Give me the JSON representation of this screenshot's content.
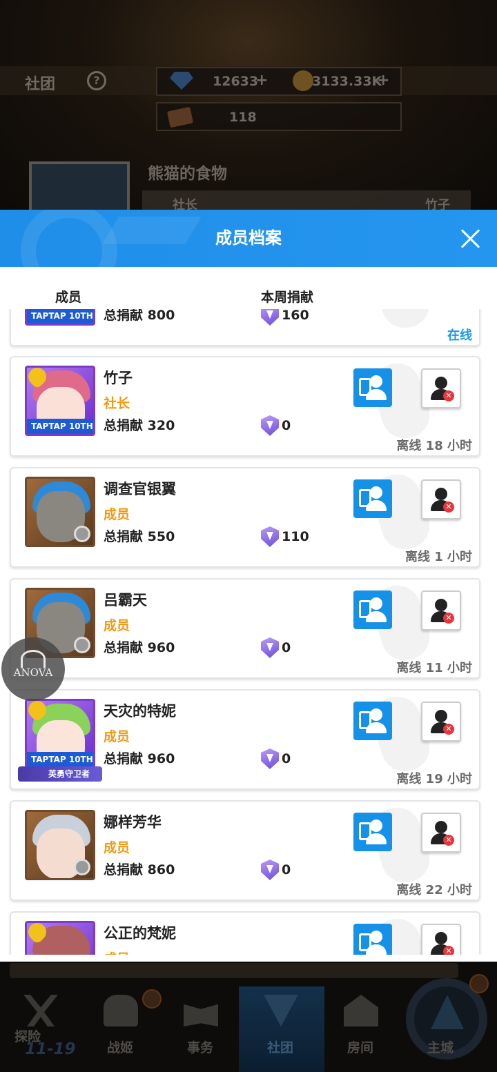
{
  "background": {
    "section_title": "社团",
    "help_icon": "?",
    "gems": "12633",
    "gold": "3133.33K",
    "tickets": "118",
    "plus": "+",
    "club_name": "熊猫的食物",
    "leader_label": "社长",
    "leader_name": "竹子"
  },
  "modal": {
    "title": "成员档案",
    "col_member": "成员",
    "col_week": "本周捐献",
    "members": [
      {
        "name": "",
        "role": "",
        "total_label": "总捐献",
        "total": "800",
        "week": "160",
        "status": "在线"
      },
      {
        "name": "竹子",
        "role": "社长",
        "total_label": "总捐献",
        "total": "320",
        "week": "0",
        "status": "离线 18 小时"
      },
      {
        "name": "调查官银翼",
        "role": "成员",
        "total_label": "总捐献",
        "total": "550",
        "week": "110",
        "status": "离线 1 小时"
      },
      {
        "name": "吕霸天",
        "role": "成员",
        "total_label": "总捐献",
        "total": "960",
        "week": "0",
        "status": "离线 11 小时"
      },
      {
        "name": "天灾的特妮",
        "role": "成员",
        "total_label": "总捐献",
        "total": "960",
        "week": "0",
        "status": "离线 19 小时",
        "badge": "英勇守卫者"
      },
      {
        "name": "娜样芳华",
        "role": "成员",
        "total_label": "总捐献",
        "total": "860",
        "week": "0",
        "status": "离线 22 小时"
      },
      {
        "name": "公正的梵妮",
        "role": "成员",
        "total_label": "",
        "total": "",
        "week": "",
        "status": ""
      }
    ],
    "taptap_label": "TAPTAP 10TH"
  },
  "watermark": "ANOVA",
  "bottom_nav": {
    "stage": "11-19",
    "items": [
      {
        "label": "探险",
        "icon": "crossed-swords-icon"
      },
      {
        "label": "战姬",
        "icon": "people-icon"
      },
      {
        "label": "事务",
        "icon": "book-icon"
      },
      {
        "label": "社团",
        "icon": "club-emblem-icon"
      },
      {
        "label": "房间",
        "icon": "house-icon"
      },
      {
        "label": "主城",
        "icon": "mountain-icon"
      }
    ],
    "active": "社团"
  },
  "colors": {
    "header_blue": "#1f8ee8",
    "role_orange": "#f09a10",
    "online_blue": "#1b9ae8",
    "kick_red": "#e8343a"
  }
}
